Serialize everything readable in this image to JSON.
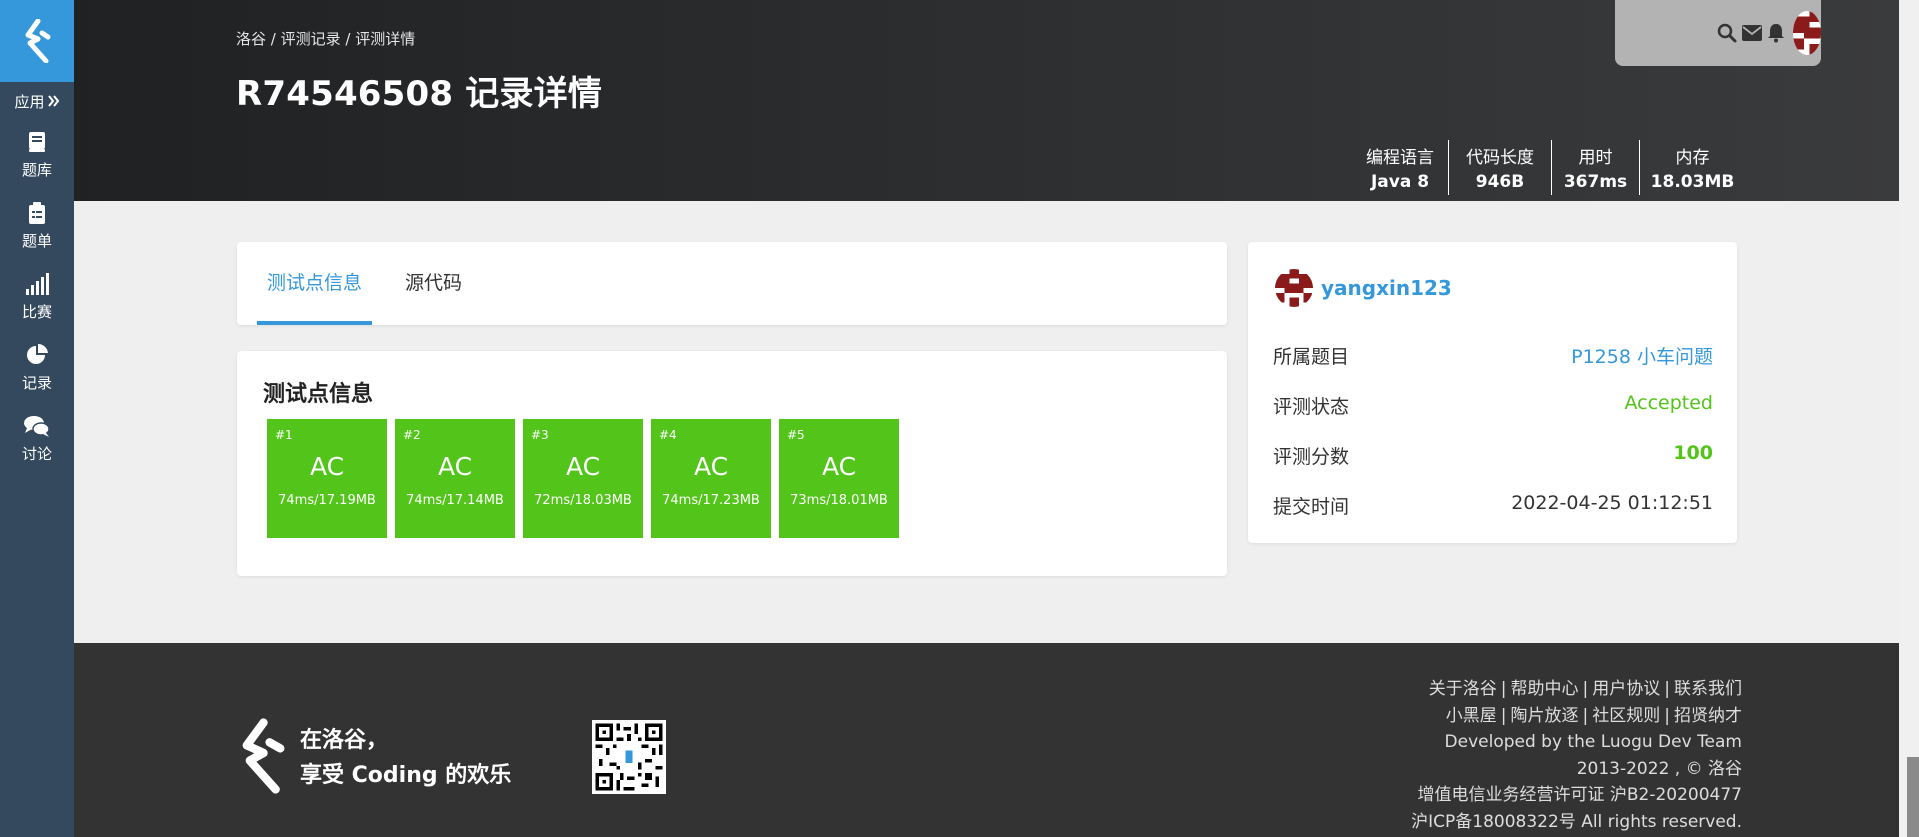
{
  "sidebar": {
    "app_label": "应用",
    "items": [
      {
        "label": "题库",
        "icon": "book-icon"
      },
      {
        "label": "题单",
        "icon": "clipboard-list-icon"
      },
      {
        "label": "比赛",
        "icon": "bar-signal-icon"
      },
      {
        "label": "记录",
        "icon": "pie-chart-icon"
      },
      {
        "label": "讨论",
        "icon": "comments-icon"
      }
    ]
  },
  "header": {
    "breadcrumb": [
      "洛谷",
      "评测记录",
      "评测详情"
    ],
    "breadcrumb_sep": " / ",
    "title": "R74546508 记录详情",
    "stats": [
      {
        "label": "编程语言",
        "value": "Java 8"
      },
      {
        "label": "代码长度",
        "value": "946B"
      },
      {
        "label": "用时",
        "value": "367ms"
      },
      {
        "label": "内存",
        "value": "18.03MB"
      }
    ]
  },
  "tabs": [
    {
      "label": "测试点信息",
      "active": true
    },
    {
      "label": "源代码",
      "active": false
    }
  ],
  "results": {
    "title": "测试点信息",
    "cases": [
      {
        "num": "#1",
        "result": "AC",
        "detail": "74ms/17.19MB"
      },
      {
        "num": "#2",
        "result": "AC",
        "detail": "74ms/17.14MB"
      },
      {
        "num": "#3",
        "result": "AC",
        "detail": "72ms/18.03MB"
      },
      {
        "num": "#4",
        "result": "AC",
        "detail": "74ms/17.23MB"
      },
      {
        "num": "#5",
        "result": "AC",
        "detail": "73ms/18.01MB"
      }
    ]
  },
  "info": {
    "username": "yangxin123",
    "rows": [
      {
        "key": "所属题目",
        "value": "P1258 小车问题"
      },
      {
        "key": "评测状态",
        "value": "Accepted"
      },
      {
        "key": "评测分数",
        "value": "100"
      },
      {
        "key": "提交时间",
        "value": "2022-04-25 01:12:51"
      }
    ]
  },
  "footer": {
    "slogan_line1": "在洛谷，",
    "slogan_line2": "享受 Coding 的欢乐",
    "links_row1": [
      "关于洛谷",
      "帮助中心",
      "用户协议",
      "联系我们"
    ],
    "links_row2": [
      "小黑屋",
      "陶片放逐",
      "社区规则",
      "招贤纳才"
    ],
    "developed_by": "Developed by the",
    "team": "Luogu Dev Team",
    "copyright": "2013-2022 , © 洛谷",
    "license": "增值电信业务经营许可证 沪B2-20200477",
    "icp": "沪ICP备18008322号 All rights reserved."
  },
  "colors": {
    "accent": "#3498db",
    "success": "#52c41a",
    "sidebar": "#34495e",
    "header": "#2d2e30",
    "footer": "#333333",
    "avatar": "#8b1a1a"
  }
}
